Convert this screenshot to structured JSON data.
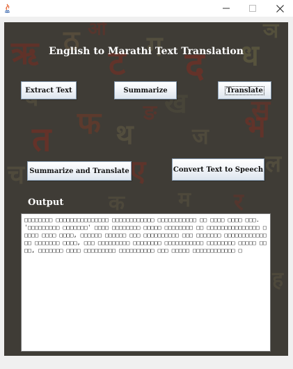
{
  "window": {
    "title": "",
    "controls": {
      "minimize_icon": "minimize-icon",
      "maximize_icon": "maximize-icon",
      "close_icon": "close-icon"
    }
  },
  "header": {
    "title": "English to Marathi Text Translation"
  },
  "buttons": {
    "extract_text": "Extract Text",
    "summarize": "Summarize",
    "translate": "Translate",
    "summarize_and_translate": "Summarize and Translate",
    "convert_text_to_speech": "Convert Text to Speech"
  },
  "output": {
    "label": "Output",
    "text": "□□□□□□□□ □□□□□□□□□□□□□□□ □□□□□□□□□□□□ □□□□□□□□□□□ □□ □□□□ □□□□ □□□. '□□□□□□□□□ □□□□□□□' □□□□ □□□□□□□□ □□□□□ □□□□□□□□ □□ □□□□□□□□□□□□□□□ □□□□□ □□□□ □□□□, □□□□□□ □□□□□□ □□□ □□□□□□□□□□ □□□ □□□□□□□ □□□□□□□□□□□□□□ □□□□□□□ □□□□, □□□ □□□□□□□□□ □□□□□□□□ □□□□□□□□□□□ □□□□□□□□ □□□□□ □□□□, □□□□□□□ □□□□ □□□□□□□□□ □□□□□□□□□□ □□□ □□□□□ □□□□□□□□□□□□ □"
  },
  "colors": {
    "background": "#3f3c36",
    "title_text": "#ffffff",
    "button_border": "#8da2b8"
  }
}
